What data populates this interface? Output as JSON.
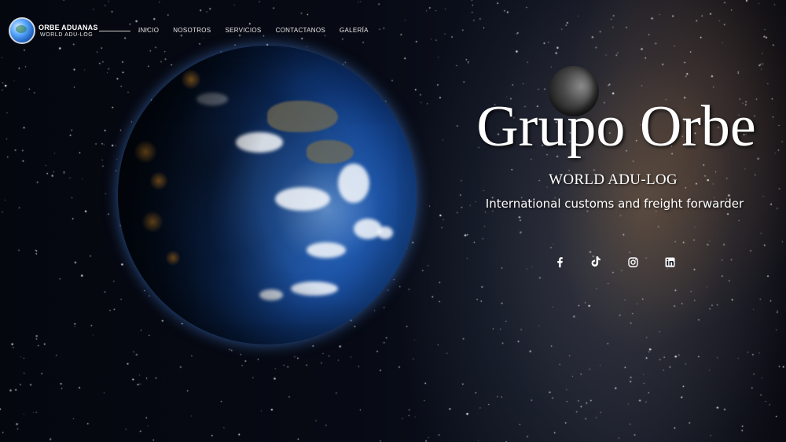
{
  "brand": {
    "name": "ORBE ADUANAS",
    "subtitle": "WORLD ADU-LOG"
  },
  "nav": {
    "items": [
      "INICIO",
      "NOSOTROS",
      "SERVICIOS",
      "CONTACTANOS",
      "GALERÍA"
    ]
  },
  "hero": {
    "title": "Grupo Orbe",
    "subtitle": "WORLD ADU-LOG",
    "tagline": "International customs and freight forwarder"
  },
  "social": {
    "icons": [
      "facebook-icon",
      "tiktok-icon",
      "instagram-icon",
      "linkedin-icon"
    ]
  },
  "colors": {
    "background": "#05070d",
    "text": "#ffffff",
    "earth_blue": "#2b78d6"
  }
}
